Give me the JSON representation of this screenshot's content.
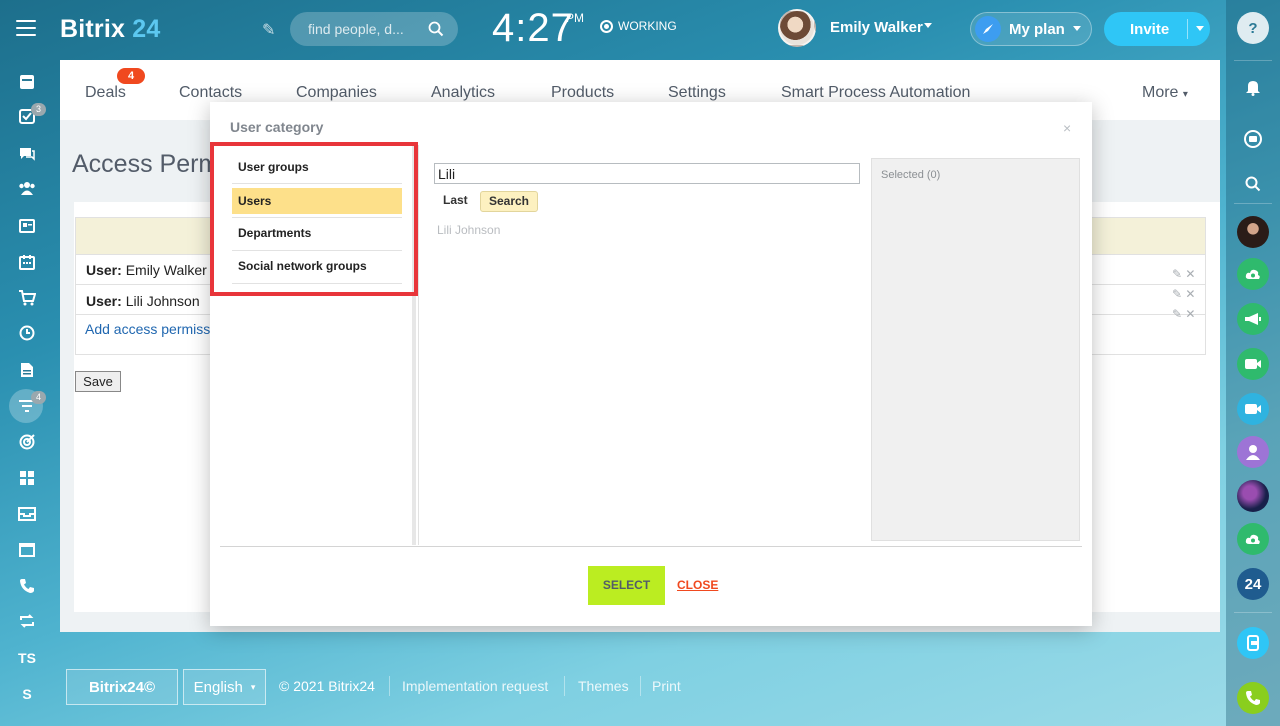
{
  "header": {
    "logo_main": "Bitrix",
    "logo_num": "24",
    "search_placeholder": "find people, d...",
    "time": "4:27",
    "ampm": "PM",
    "status": "WORKING",
    "user_name": "Emily Walker",
    "myplan_label": "My plan",
    "invite_label": "Invite"
  },
  "left_sidebar": {
    "badges": {
      "tasks": "3",
      "filter": "4"
    },
    "ts_label": "TS",
    "s_label": "S"
  },
  "nav": {
    "items": [
      "Deals",
      "Contacts",
      "Companies",
      "Analytics",
      "Products",
      "Settings",
      "Smart Process Automation"
    ],
    "more": "More",
    "deals_badge": "4"
  },
  "page": {
    "title": "Access Perm",
    "rows": [
      {
        "prefix": "User:",
        "name": "Emily Walker"
      },
      {
        "prefix": "User:",
        "name": "Lili Johnson"
      }
    ],
    "add_link": "Add access permiss",
    "save_label": "Save"
  },
  "modal": {
    "title": "User category",
    "close_x": "×",
    "categories": [
      "User groups",
      "Users",
      "Departments",
      "Social network groups"
    ],
    "active_category": "Users",
    "search_value": "Lili",
    "last_tab": "Last",
    "search_button": "Search",
    "result": "Lili Johnson",
    "selected_label": "Selected (0)",
    "select_button": "SELECT",
    "close_button": "CLOSE"
  },
  "footer": {
    "logo": "Bitrix24©",
    "language": "English",
    "copyright": "© 2021 Bitrix24",
    "links": [
      "Implementation request",
      "Themes",
      "Print"
    ]
  },
  "right_sidebar": {
    "badge_24": "24"
  },
  "colors": {
    "accent_blue": "#2fc6f6",
    "highlight_red": "#e8353a",
    "active_yellow": "#fde08a",
    "select_green": "#bbed21",
    "close_red": "#f0491f"
  }
}
